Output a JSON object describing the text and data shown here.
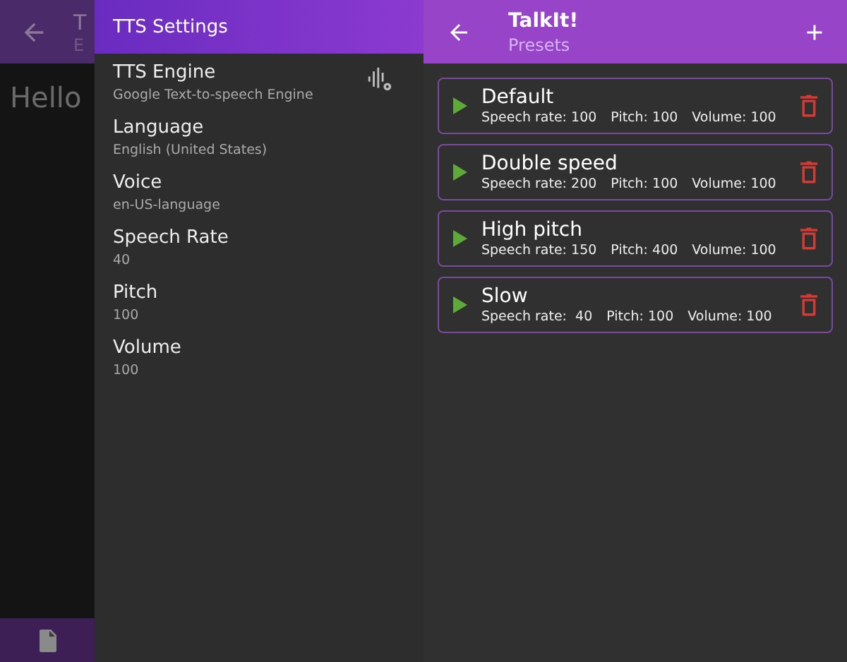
{
  "background_app": {
    "title": "T",
    "subtitle": "E",
    "content": "Hello"
  },
  "tts_settings": {
    "title": "TTS Settings",
    "items": [
      {
        "label": "TTS Engine",
        "value": "Google Text-to-speech Engine",
        "kind": "engine"
      },
      {
        "label": "Language",
        "value": "English (United States)",
        "kind": "plain"
      },
      {
        "label": "Voice",
        "value": "en-US-language",
        "kind": "plain"
      },
      {
        "label": "Speech Rate",
        "value": "40",
        "kind": "plain"
      },
      {
        "label": "Pitch",
        "value": "100",
        "kind": "plain"
      },
      {
        "label": "Volume",
        "value": "100",
        "kind": "plain"
      }
    ]
  },
  "app_bar": {
    "title": "TalkIt!",
    "subtitle": "Presets"
  },
  "presets": [
    {
      "name": "Default",
      "rate": "Speech rate: 100",
      "pitch": "Pitch: 100",
      "volume": "Volume: 100"
    },
    {
      "name": "Double speed",
      "rate": "Speech rate: 200",
      "pitch": "Pitch: 100",
      "volume": "Volume: 100"
    },
    {
      "name": "High pitch",
      "rate": "Speech rate: 150",
      "pitch": "Pitch: 400",
      "volume": "Volume: 100"
    },
    {
      "name": "Slow",
      "rate": "Speech rate:  40",
      "pitch": "Pitch: 100",
      "volume": "Volume: 100"
    }
  ]
}
